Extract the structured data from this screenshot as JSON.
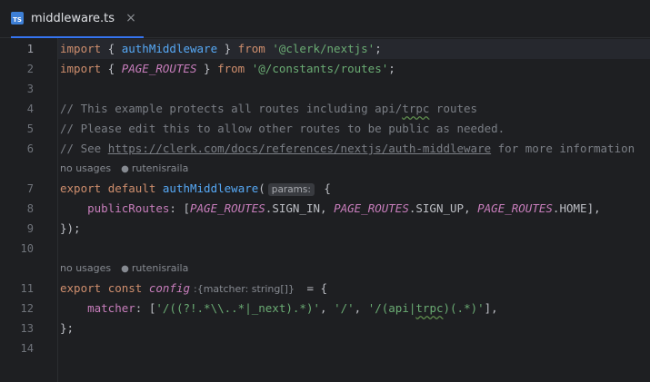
{
  "tab": {
    "icon": "ts-file-icon",
    "icon_text": "TS",
    "label": "middleware.ts",
    "close_glyph": "×"
  },
  "line_numbers": [
    "1",
    "2",
    "3",
    "4",
    "5",
    "6",
    "7",
    "8",
    "9",
    "10",
    "11",
    "12",
    "13",
    "14"
  ],
  "hints": {
    "usage_text": "no usages",
    "author": "rutenisraila",
    "user_icon": "user-icon"
  },
  "code": {
    "l1": {
      "import": "import",
      "brace_open": " { ",
      "name": "authMiddleware",
      "brace_close": " } ",
      "from": "from",
      "src": "'@clerk/nextjs'",
      "end": ";"
    },
    "l2": {
      "import": "import",
      "brace_open": " { ",
      "name": "PAGE_ROUTES",
      "brace_close": " } ",
      "from": "from",
      "src": "'@/constants/routes'",
      "end": ";"
    },
    "l4": {
      "pre": "// This example protects all routes including api/",
      "typo": "trpc",
      "post": " routes"
    },
    "l5": {
      "text": "// Please edit this to allow other routes to be public as needed."
    },
    "l6": {
      "pre": "// See ",
      "link": "https://clerk.com/docs/references/nextjs/auth-middleware",
      "post": " for more information"
    },
    "l7": {
      "export": "export",
      "default": "default",
      "fn": "authMiddleware",
      "paren": "(",
      "param_hint": "params:",
      "brace": " {"
    },
    "l8": {
      "indent": "    ",
      "key": "publicRoutes",
      "colon": ": [",
      "c1": "PAGE_ROUTES",
      "p1": ".SIGN_IN, ",
      "c2": "PAGE_ROUTES",
      "p2": ".SIGN_UP, ",
      "c3": "PAGE_ROUTES",
      "p3": ".HOME",
      "end": "],"
    },
    "l9": {
      "text": "});"
    },
    "l11": {
      "export": "export",
      "const": "const",
      "name": "config",
      "type_hint": ":{matcher: string[]}",
      "assign": " = {"
    },
    "l12": {
      "indent": "    ",
      "key": "matcher",
      "colon": ": [",
      "s1": "'/((?!.*\\\\..*|_next).*)'",
      "sep1": ", ",
      "s2": "'/'",
      "sep2": ", ",
      "s3a": "'/(api|",
      "s3typo": "trpc",
      "s3b": ")(.*)'",
      "end": "],"
    },
    "l13": {
      "text": "};"
    }
  }
}
